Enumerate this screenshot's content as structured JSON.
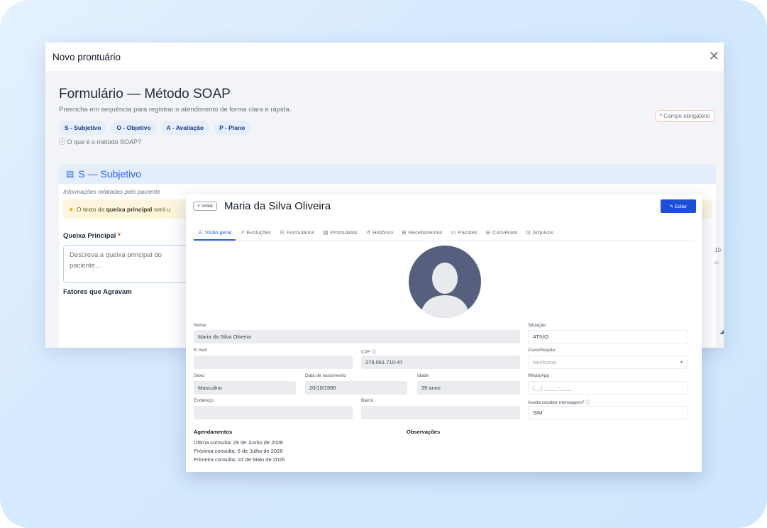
{
  "modal": {
    "title": "Novo prontuário",
    "close_glyph": "✕",
    "form_title": "Formulário — Método SOAP",
    "form_subtitle": "Preencha em sequência para registrar o atendimento de forma clara e rápida.",
    "required_badge": "Campo obrigatório",
    "soap_tabs": [
      "S - Subjetivo",
      "O - Objetivo",
      "A - Avaliação",
      "P - Plano"
    ],
    "soap_help": "ⓘ O que é o método SOAP?",
    "section": {
      "title": "S — Subjetivo",
      "note": "Informações relatadas pelo paciente",
      "warning_prefix": "O texto da ",
      "warning_bold": "queixa principal",
      "warning_suffix": " será u",
      "queixa_label": "Queixa Principal",
      "queixa_placeholder": "Descreva a queixa principal do paciente...",
      "fatores_label": "Fatores que Agravam",
      "right_number": "10",
      "right_small": "uíl"
    }
  },
  "card": {
    "back_label": "+ Voltar",
    "patient_name": "Maria da Silva Oliveira",
    "edit_label": "✎ Editar",
    "tabs": [
      {
        "icon": "♙",
        "label": "Visão geral"
      },
      {
        "icon": "↗",
        "label": "Evoluções"
      },
      {
        "icon": "☷",
        "label": "Formulários"
      },
      {
        "icon": "▤",
        "label": "Prontuários"
      },
      {
        "icon": "↺",
        "label": "Histórico"
      },
      {
        "icon": "⊞",
        "label": "Recebimentos"
      },
      {
        "icon": "▭",
        "label": "Pacotes"
      },
      {
        "icon": "⊟",
        "label": "Convênios"
      },
      {
        "icon": "⊡",
        "label": "Arquivos"
      }
    ],
    "fields": {
      "nome_label": "Nome",
      "nome_value": "Maria da Silva Oliveira",
      "situacao_label": "Situação",
      "situacao_value": "ATIVO",
      "email_label": "E-mail",
      "email_value": "",
      "cpf_label": "CPF ⓘ",
      "cpf_value": "279.061.710-47",
      "classificacao_label": "Classificação",
      "classificacao_value": "Nenhuma",
      "sexo_label": "Sexo",
      "sexo_value": "Masculino",
      "nascimento_label": "Data de nascimento",
      "nascimento_value": "20/10/1986",
      "idade_label": "Idade",
      "idade_value": "39 anos",
      "whatsapp_label": "WhatsApp",
      "whatsapp_value": "(__) _____-____",
      "endereco_label": "Endereço",
      "bairro_label": "Bairro",
      "aceita_label": "Aceita receber mensagem? ⓘ",
      "aceita_value": "SIM"
    },
    "agendamentos_title": "Agendamentos",
    "observacoes_title": "Observações",
    "schedule": [
      "Última consulta: 29 de Junho de 2026",
      "Próxima consulta: 6 de Julho de 2026",
      "Primeira consulta: 22 de Maio de 2026"
    ]
  }
}
